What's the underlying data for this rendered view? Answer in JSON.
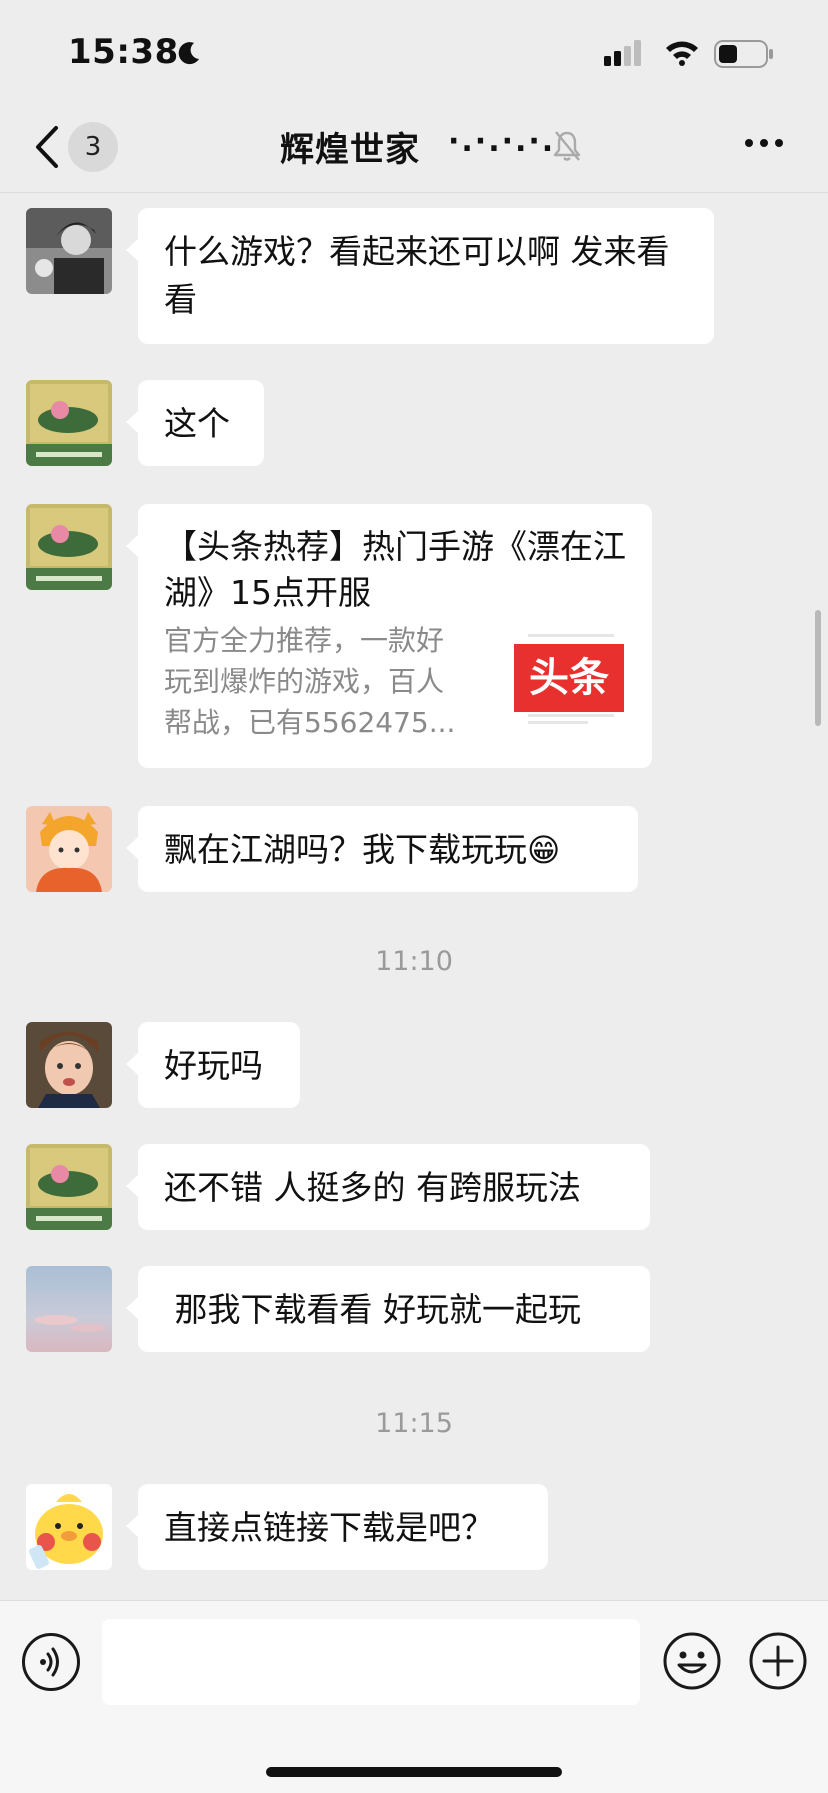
{
  "status_bar": {
    "time": "15:38"
  },
  "nav": {
    "unread_count": "3",
    "title": "辉煌世家",
    "title_dots": "·.·.·.·."
  },
  "messages": [
    {
      "text": "什么游戏？看起来还可以啊 发来看看"
    },
    {
      "text": "这个"
    },
    {
      "card": {
        "title": "【头条热荐】热门手游《漂在江湖》15点开服",
        "description": "官方全力推荐，一款好玩到爆炸的游戏，百人帮战，已有5562475...",
        "thumb_label": "头条"
      }
    },
    {
      "text": "飘在江湖吗？我下载玩玩",
      "emoji": "😁"
    },
    {
      "timestamp": "11:10"
    },
    {
      "text": "好玩吗"
    },
    {
      "text": "还不错 人挺多的 有跨服玩法"
    },
    {
      "text": " 那我下载看看 好玩就一起玩"
    },
    {
      "timestamp": "11:15"
    },
    {
      "text": "直接点链接下载是吧？"
    }
  ],
  "input": {
    "placeholder": ""
  },
  "colors": {
    "background": "#ededed",
    "bubble": "#ffffff",
    "brand_red": "#e8312f"
  }
}
